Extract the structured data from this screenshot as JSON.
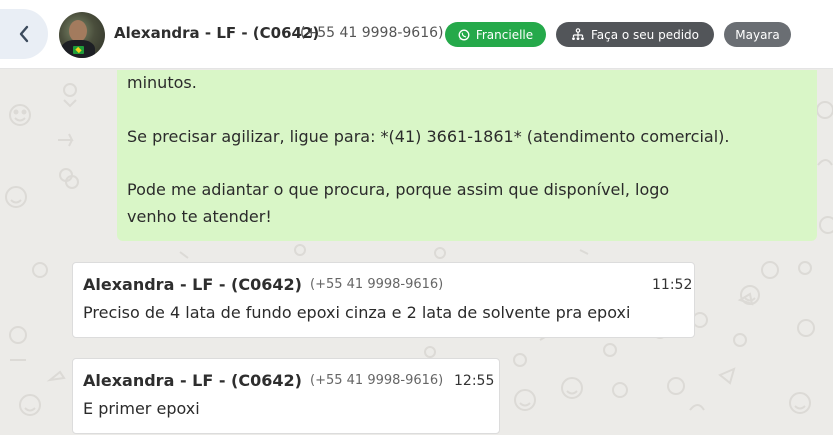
{
  "header": {
    "contact_name": "Alexandra - LF - (C0642)",
    "contact_phone": "(+55 41 9998-9616)",
    "agent_button_label": "Francielle",
    "order_button_label": "Faça o seu pedido",
    "user_badge_label": "Mayara"
  },
  "messages": {
    "outgoing": {
      "line1": "minutos.",
      "line2": "Se precisar agilizar, ligue para: *(41) 3661-1861* (atendimento comercial).",
      "line3": "Pode me adiantar o que procura, porque assim que disponível, logo",
      "line4": "venho te atender!"
    },
    "incoming": [
      {
        "sender": "Alexandra - LF - (C0642)",
        "phone": "(+55 41 9998-9616)",
        "time": "11:52",
        "text": "Preciso de 4 lata de fundo epoxi cinza e 2 lata de solvente pra epoxi"
      },
      {
        "sender": "Alexandra - LF - (C0642)",
        "phone": "(+55 41 9998-9616)",
        "time": "12:55",
        "text": "E primer epoxi"
      }
    ]
  },
  "colors": {
    "outgoing_bubble": "#d9f6c7",
    "whatsapp_green": "#25a94a",
    "order_button": "#525559",
    "user_badge": "#6a6e73"
  },
  "icons": {
    "back": "chevron-left-icon",
    "whatsapp": "whatsapp-icon",
    "order": "hierarchy-icon"
  }
}
